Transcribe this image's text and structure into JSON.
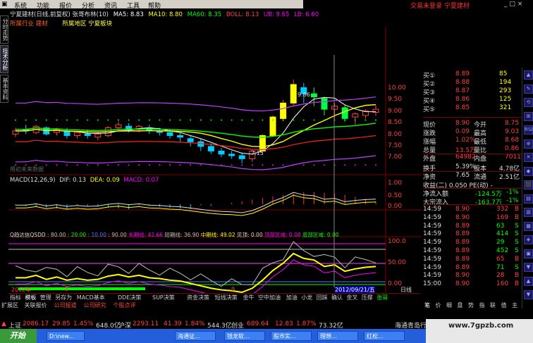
{
  "menu": {
    "items": [
      "系统",
      "功能",
      "报价",
      "分析",
      "资讯",
      "工具",
      "帮助"
    ]
  },
  "status": {
    "text": "交易未登录  宁夏建材"
  },
  "window_controls": "_ □ ×",
  "header": {
    "stock_title": "宁夏建材(日线,前复权) 张哥布林(10)",
    "ma5_label": "MA5: 8.83",
    "ma10_label": "MA10: 8.80",
    "ma60_label": "MA60: 8.35",
    "boll_label": "BOLL: 8.13",
    "ub_label": "UB: 9.65",
    "lb_label": "LB: 6.60",
    "industry": "所属行业 建材",
    "region": "所属地区 宁夏板块"
  },
  "left_tabs": [
    "分时走势",
    "技术分析",
    "基本资料"
  ],
  "price_axis": [
    "10.00",
    "9.50",
    "9.00",
    "8.50",
    "8.00",
    "7.50",
    "7.00"
  ],
  "annotations": {
    "high": "9.86",
    "low": "7.15",
    "watermark": "用初未来数据"
  },
  "macd": {
    "label": "MACD(12,26,9)",
    "dif": "DIF: 0.13",
    "dea": "DEA: 0.09",
    "macd": "MACD: 0.07",
    "axis": [
      "1.00",
      "0.50",
      "0.00"
    ]
  },
  "qsdd": {
    "label": "Q趋达信QSDD",
    "values": [
      ": 80.00",
      ": 20.00",
      ": 10.00",
      ": 90.00"
    ],
    "long": "长期线: 42.66",
    "short": "短期线: 36.90",
    "mid": "中期线: 49.02",
    "top": "见顶: 0.00",
    "top_zone": "顶部区域: 0.00",
    "bottom_zone": "底部区域: 0.00",
    "axis": [
      "100.0",
      "50.00",
      "0.00"
    ]
  },
  "date_axis": {
    "year": "2012年",
    "m8": "8",
    "m9": "9",
    "cursor": "2012/09/21/五",
    "period": "日线"
  },
  "quote": {
    "asks": [
      {
        "label": "买①",
        "price": "8.89",
        "vol": "85"
      },
      {
        "label": "买②",
        "price": "8.88",
        "vol": "194"
      },
      {
        "label": "买③",
        "price": "8.87",
        "vol": "293"
      },
      {
        "label": "买④",
        "price": "8.86",
        "vol": "125"
      },
      {
        "label": "买⑤",
        "price": "8.85",
        "vol": "321"
      }
    ],
    "rows": [
      [
        "现价",
        "8.90",
        "今开",
        "8.75"
      ],
      [
        "涨跌",
        "0.09",
        "最高",
        "9.03"
      ],
      [
        "涨幅",
        "1.02%",
        "最低",
        "8.68"
      ],
      [
        "总量",
        "13.5万",
        "量比",
        "0.86"
      ],
      [
        "外盘",
        "64982",
        "内盘",
        "70115"
      ]
    ],
    "rows2": [
      [
        "换手",
        "5.39%",
        "股本",
        "4.78亿"
      ],
      [
        "净资",
        "7.65",
        "流通",
        "2.51亿"
      ]
    ],
    "pe": "收益(二) 0.050  PE(动)  -",
    "inflow": [
      [
        "净流入额",
        "-124.5万",
        "-1%"
      ],
      [
        "大宗流入",
        "-163.7万",
        "-1%"
      ]
    ],
    "ticks": [
      [
        "14:59",
        "8.90",
        "332",
        "B"
      ],
      [
        "14:59",
        "8.90",
        "169",
        "B"
      ],
      [
        "14:59",
        "8.89",
        "63",
        "S"
      ],
      [
        "14:59",
        "8.89",
        "414",
        "S"
      ],
      [
        "14:59",
        "8.89",
        "29",
        "S"
      ],
      [
        "14:59",
        "8.89",
        "452",
        "S"
      ],
      [
        "14:59",
        "8.89",
        "65",
        "B"
      ],
      [
        "14:59",
        "8.89",
        "71",
        "S"
      ],
      [
        "14:59",
        "8.90",
        "28",
        "B"
      ],
      [
        "15:00",
        "8.90",
        "160",
        "B"
      ]
    ]
  },
  "tabs_row1": [
    "指标",
    "模板",
    "管理",
    "另存为",
    "MACD基本",
    "DDE决策",
    "SUP决策",
    "资金决策",
    "短线决策",
    "金牛",
    "空中加油",
    "加油",
    "小龙",
    "回踩",
    "确认",
    "金叉",
    "压撑",
    "张哥"
  ],
  "tabs_row2": [
    "扩展区",
    "关联报价",
    "公司报道",
    "公司研究",
    "个股点评"
  ],
  "right_tabs": [
    "笔",
    "价",
    "细",
    "盘",
    "势",
    "指",
    "联",
    "值",
    "主"
  ],
  "ticker": {
    "sh_label": "上证",
    "sh_val": "2086.17",
    "sh_chg": "29.85",
    "sh_pct": "1.45%",
    "sh_amt": "648.0亿",
    "sz_label": "沪深",
    "sz_val": "2293.11",
    "sz_chg": "41.39",
    "sz_pct": "1.84%",
    "sz_amt": "544.3亿",
    "cy_label": "创业",
    "cy_val": "689.64",
    "cy_chg": "12.83",
    "cy_pct": "1.87%",
    "cy_amt": "73.32亿",
    "right": "海通青岛行"
  },
  "taskbar": {
    "start": "开始",
    "items": [
      "D:\\new...",
      "海通证...",
      "钱龙软...",
      "股市实...",
      "理想...",
      "红松..."
    ]
  },
  "watermark": "www.7gpzb.com",
  "chart_data": {
    "type": "candlestick",
    "note_series": [
      "MA5",
      "MA10",
      "MA60",
      "BOLL",
      "UB",
      "LB"
    ],
    "candles": [
      [
        8.1,
        8.3,
        8.2,
        8.0
      ],
      [
        8.25,
        8.4,
        8.2,
        8.1
      ],
      [
        8.15,
        8.4,
        8.35,
        8.1
      ],
      [
        8.3,
        8.35,
        8.1,
        8.05
      ],
      [
        8.15,
        8.3,
        8.25,
        8.05
      ],
      [
        8.2,
        8.3,
        8.05,
        7.95
      ],
      [
        8.05,
        8.2,
        8.15,
        7.95
      ],
      [
        8.1,
        8.25,
        8.05,
        7.95
      ],
      [
        8.0,
        8.15,
        8.1,
        7.9
      ],
      [
        8.05,
        8.35,
        8.3,
        8.0
      ],
      [
        8.3,
        8.5,
        8.4,
        8.2
      ],
      [
        8.35,
        8.45,
        8.25,
        8.15
      ],
      [
        8.25,
        8.4,
        8.35,
        8.15
      ],
      [
        8.3,
        8.4,
        8.2,
        8.1
      ],
      [
        8.2,
        8.3,
        8.15,
        8.05
      ],
      [
        8.15,
        8.25,
        8.05,
        7.95
      ],
      [
        8.05,
        8.15,
        8.0,
        7.85
      ],
      [
        7.95,
        8.05,
        7.85,
        7.7
      ],
      [
        7.85,
        7.95,
        7.7,
        7.55
      ],
      [
        7.7,
        7.8,
        7.55,
        7.45
      ],
      [
        7.55,
        7.65,
        7.45,
        7.35
      ],
      [
        7.45,
        7.55,
        7.4,
        7.3
      ],
      [
        7.4,
        7.5,
        7.3,
        7.15
      ],
      [
        7.3,
        7.6,
        7.55,
        7.2
      ],
      [
        7.55,
        8.1,
        8.05,
        7.5
      ],
      [
        8.05,
        8.7,
        8.65,
        8.0
      ],
      [
        8.6,
        9.2,
        9.1,
        8.5
      ],
      [
        9.1,
        9.86,
        9.7,
        9.0
      ],
      [
        9.6,
        9.75,
        9.4,
        9.1
      ],
      [
        9.4,
        9.6,
        9.3,
        9.0
      ],
      [
        9.25,
        9.3,
        8.9,
        8.7
      ],
      [
        8.9,
        9.1,
        9.0,
        8.6
      ],
      [
        8.95,
        9.05,
        8.6,
        8.5
      ],
      [
        8.65,
        8.8,
        8.75,
        8.4
      ],
      [
        8.7,
        8.9,
        8.85,
        8.6
      ],
      [
        8.8,
        9.03,
        8.9,
        8.68
      ]
    ],
    "ylim": [
      6.9,
      10.2
    ]
  }
}
